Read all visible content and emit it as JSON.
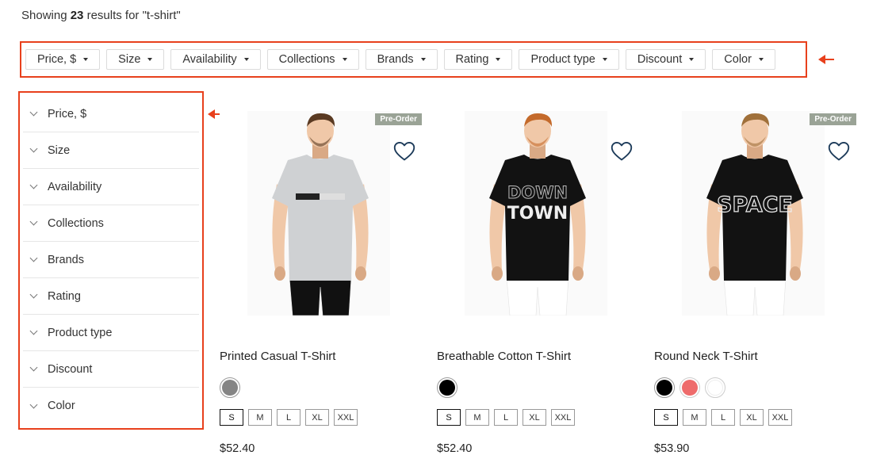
{
  "results": {
    "prefix": "Showing",
    "count": "23",
    "suffix": "results for \"t-shirt\""
  },
  "filters": [
    "Price, $",
    "Size",
    "Availability",
    "Collections",
    "Brands",
    "Rating",
    "Product type",
    "Discount",
    "Color"
  ],
  "sidebar": [
    "Price, $",
    "Size",
    "Availability",
    "Collections",
    "Brands",
    "Rating",
    "Product type",
    "Discount",
    "Color"
  ],
  "colors": {
    "accent": "#e8401c",
    "badge": "#9aa396",
    "heart": "#1d3b5a"
  },
  "products": [
    {
      "name": "Printed Casual T-Shirt",
      "badge": "Pre-Order",
      "price": "$52.40",
      "swatches": [
        "#858585"
      ],
      "sizes": [
        "S",
        "M",
        "L",
        "XL",
        "XXL"
      ],
      "selected_size": "S",
      "shirt": "#cfd1d3",
      "pants": "#111111",
      "graphic": "stripe",
      "hair": "#5a3a22"
    },
    {
      "name": "Breathable Cotton T-Shirt",
      "badge": "",
      "price": "$52.40",
      "swatches": [
        "#000000"
      ],
      "sizes": [
        "S",
        "M",
        "L",
        "XL",
        "XXL"
      ],
      "selected_size": "S",
      "shirt": "#121212",
      "pants": "#ffffff",
      "graphic": "DOWN TOWN",
      "hair": "#c46a2b"
    },
    {
      "name": "Round Neck T-Shirt",
      "badge": "Pre-Order",
      "price": "$53.90",
      "swatches": [
        "#000000",
        "#ee6b6b",
        "#ffffff"
      ],
      "sizes": [
        "S",
        "M",
        "L",
        "XL",
        "XXL"
      ],
      "selected_size": "S",
      "shirt": "#121212",
      "pants": "#ffffff",
      "graphic": "SPACE",
      "hair": "#a0703a"
    }
  ]
}
